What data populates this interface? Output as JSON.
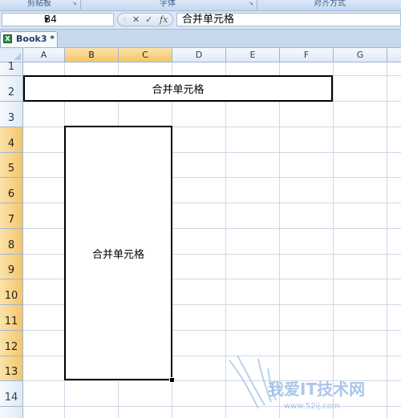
{
  "ribbon": {
    "groups": [
      "剪贴板",
      "字体",
      "对齐方式"
    ]
  },
  "formula_bar": {
    "name_box": "B4",
    "cancel_icon": "✕",
    "enter_icon": "✓",
    "fx_label": "fx",
    "content": "合并单元格"
  },
  "workbook": {
    "tab_label": "Book3 *"
  },
  "sheet": {
    "columns": [
      "A",
      "B",
      "C",
      "D",
      "E",
      "F",
      "G"
    ],
    "rows": [
      "1",
      "2",
      "3",
      "4",
      "5",
      "6",
      "7",
      "8",
      "9",
      "10",
      "11",
      "12",
      "13",
      "14"
    ],
    "selected_columns": [
      "B",
      "C"
    ],
    "selected_rows": [
      "4",
      "5",
      "6",
      "7",
      "8",
      "9",
      "10",
      "11",
      "12",
      "13"
    ],
    "merged_row2": "合并单元格",
    "merged_b4_c13": "合并单元格"
  },
  "watermark": {
    "text": "我爱IT技术网",
    "url": "www.52ij.com"
  },
  "colors": {
    "header_selected": "#f5c56b",
    "gridline": "#d0d7e5",
    "header_border": "#9eb6ce"
  }
}
